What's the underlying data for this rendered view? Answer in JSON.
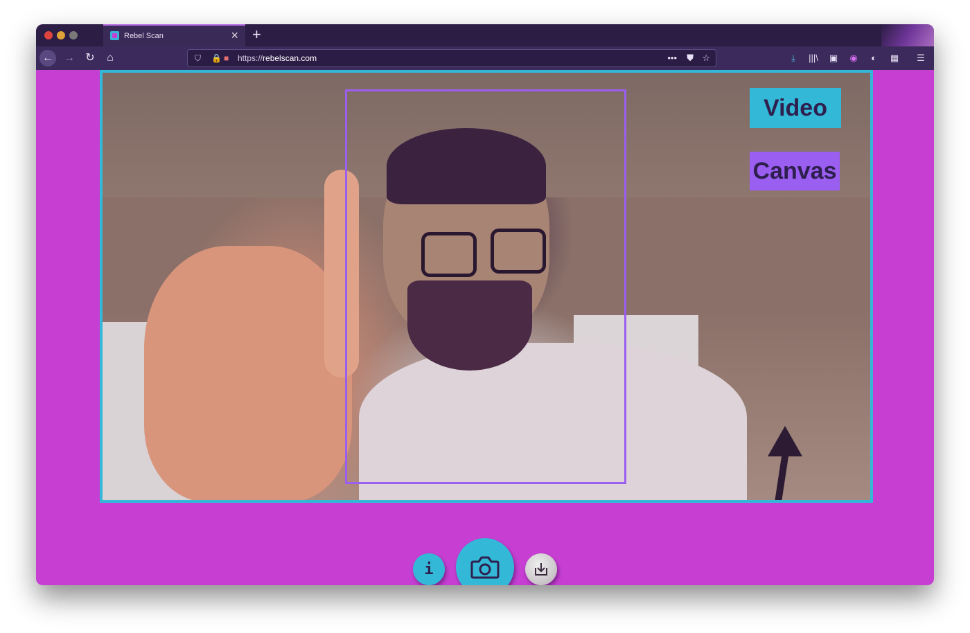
{
  "browser": {
    "tab_title": "Rebel Scan",
    "tab_close": "×",
    "new_tab": "+",
    "url_prefix": "https://",
    "url_host": "rebelscan.com",
    "nav": {
      "back": "←",
      "forward": "→",
      "reload": "↻",
      "home": "⌂"
    },
    "url_icons": {
      "shield": "⛉",
      "lock": "🔒",
      "camera": "■",
      "more": "•••",
      "pocket": "⛊",
      "star": "☆"
    },
    "toolbar": {
      "download": "⤓",
      "library": "|||\\",
      "sidebar": "▣",
      "account": "◉",
      "ext1": "◐",
      "ext2": "▦",
      "menu": "☰"
    }
  },
  "app": {
    "mode_video_label": "Video",
    "mode_canvas_label": "Canvas",
    "info_label": "i",
    "accent_cyan": "#34b8d8",
    "accent_purple": "#9a5ef0",
    "background_magenta": "#c63fd2"
  }
}
